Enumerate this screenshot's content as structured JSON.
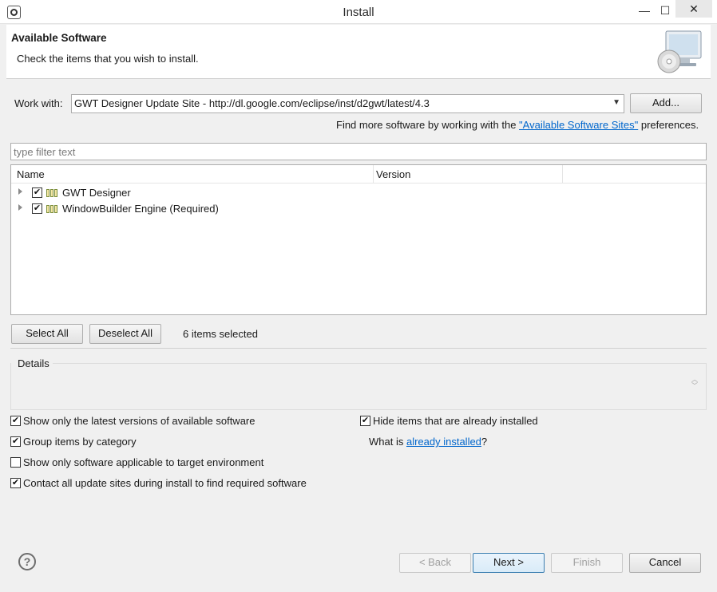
{
  "window": {
    "title": "Install",
    "minimize": "—",
    "maximize": "☐",
    "close": "✕"
  },
  "header": {
    "title": "Available Software",
    "message": "Check the items that you wish to install."
  },
  "work_with": {
    "label": "Work with:",
    "value": "GWT Designer Update Site - http://dl.google.com/eclipse/inst/d2gwt/latest/4.3",
    "add_button": "Add..."
  },
  "find_more": {
    "prefix": "Find more software by working with the ",
    "link": "\"Available Software Sites\"",
    "suffix": " preferences."
  },
  "filter": {
    "placeholder": "type filter text"
  },
  "table": {
    "columns": [
      "Name",
      "Version"
    ],
    "rows": [
      {
        "name": "GWT Designer",
        "version": "",
        "checked": true
      },
      {
        "name": "WindowBuilder Engine (Required)",
        "version": "",
        "checked": true
      }
    ]
  },
  "selection": {
    "select_all": "Select All",
    "deselect_all": "Deselect All",
    "status": "6 items selected"
  },
  "details": {
    "label": "Details"
  },
  "options": {
    "latest_versions": {
      "label": "Show only the latest versions of available software",
      "checked": true
    },
    "group_by_category": {
      "label": "Group items by category",
      "checked": true
    },
    "target_env": {
      "label": "Show only software applicable to target environment",
      "checked": false
    },
    "contact_sites": {
      "label": "Contact all update sites during install to find required software",
      "checked": true
    },
    "hide_installed": {
      "label": "Hide items that are already installed",
      "checked": true
    },
    "what_is_prefix": "What is ",
    "what_is_link": "already installed",
    "what_is_suffix": "?"
  },
  "footer": {
    "help": "?",
    "back": "< Back",
    "next": "Next >",
    "finish": "Finish",
    "cancel": "Cancel"
  },
  "colors": {
    "link": "#0066cc",
    "accent_border": "#3c7fb1"
  }
}
